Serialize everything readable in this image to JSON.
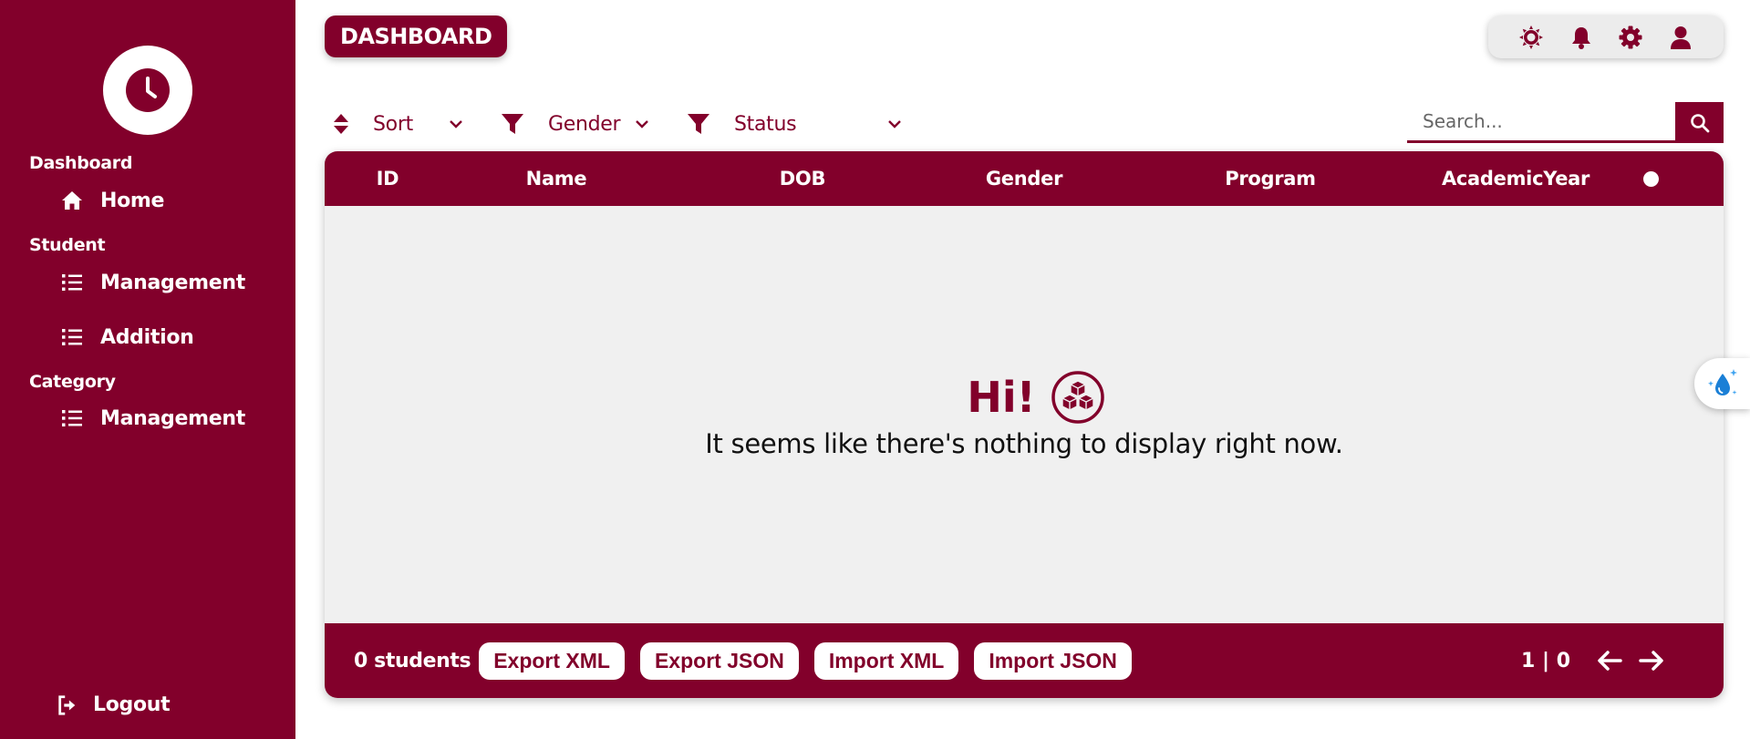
{
  "sidebar": {
    "sections": {
      "dashboard": "Dashboard",
      "student": "Student",
      "category": "Category"
    },
    "items": {
      "home": "Home",
      "student_management": "Management",
      "student_addition": "Addition",
      "category_management": "Management"
    },
    "logout": "Logout"
  },
  "header": {
    "title": "DASHBOARD",
    "icons": [
      "sun-icon",
      "bell-icon",
      "gear-icon",
      "user-icon"
    ]
  },
  "filters": {
    "sort": "Sort",
    "gender": "Gender",
    "status": "Status"
  },
  "search": {
    "placeholder": "Search..."
  },
  "table": {
    "columns": [
      "ID",
      "Name",
      "DOB",
      "Gender",
      "Program",
      "AcademicYear"
    ],
    "rows": []
  },
  "empty_state": {
    "title": "Hi!",
    "message": "It seems like there's nothing to display right now."
  },
  "footer": {
    "count": "0 students",
    "buttons": {
      "export_xml": "Export XML",
      "export_json": "Export JSON",
      "import_xml": "Import XML",
      "import_json": "Import JSON"
    },
    "pagination": "1 | 0"
  },
  "colors": {
    "brand": "#82002b",
    "panel": "#f0f0f0"
  }
}
